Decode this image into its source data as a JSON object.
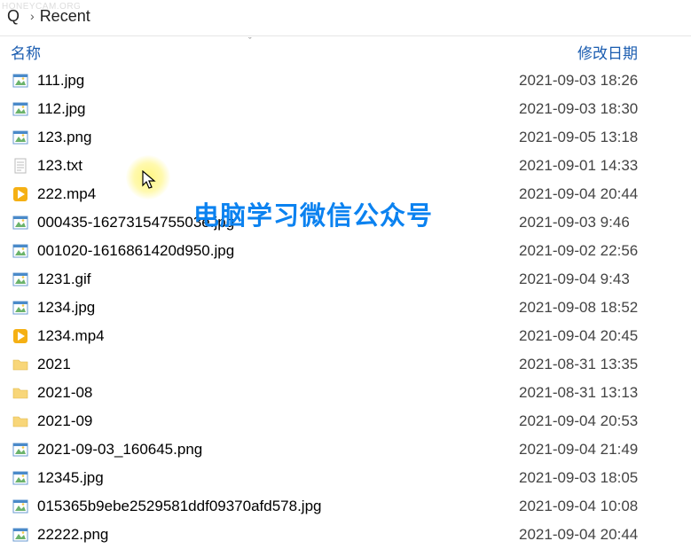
{
  "watermark_corner": "HONEYCAM.ORG",
  "breadcrumb": {
    "drive": "Q",
    "chevron": "›",
    "folder": "Recent"
  },
  "headers": {
    "name": "名称",
    "modified": "修改日期",
    "sort_indicator": "ˇ"
  },
  "overlay_text": "电脑学习微信公众号",
  "files": [
    {
      "icon": "image",
      "name": "111.jpg",
      "date": "2021-09-03 18:26"
    },
    {
      "icon": "image",
      "name": "112.jpg",
      "date": "2021-09-03 18:30"
    },
    {
      "icon": "image",
      "name": "123.png",
      "date": "2021-09-05 13:18"
    },
    {
      "icon": "text",
      "name": "123.txt",
      "date": "2021-09-01 14:33"
    },
    {
      "icon": "video",
      "name": "222.mp4",
      "date": "2021-09-04 20:44"
    },
    {
      "icon": "image",
      "name": "000435-1627315475503e.jpg",
      "date": "2021-09-03 9:46"
    },
    {
      "icon": "image",
      "name": "001020-1616861420d950.jpg",
      "date": "2021-09-02 22:56"
    },
    {
      "icon": "image",
      "name": "1231.gif",
      "date": "2021-09-04 9:43"
    },
    {
      "icon": "image",
      "name": "1234.jpg",
      "date": "2021-09-08 18:52"
    },
    {
      "icon": "video",
      "name": "1234.mp4",
      "date": "2021-09-04 20:45"
    },
    {
      "icon": "folder",
      "name": "2021",
      "date": "2021-08-31 13:35"
    },
    {
      "icon": "folder",
      "name": "2021-08",
      "date": "2021-08-31 13:13"
    },
    {
      "icon": "folder",
      "name": "2021-09",
      "date": "2021-09-04 20:53"
    },
    {
      "icon": "image",
      "name": "2021-09-03_160645.png",
      "date": "2021-09-04 21:49"
    },
    {
      "icon": "image",
      "name": "12345.jpg",
      "date": "2021-09-03 18:05"
    },
    {
      "icon": "image",
      "name": "015365b9ebe2529581ddf09370afd578.jpg",
      "date": "2021-09-04 10:08"
    },
    {
      "icon": "image",
      "name": "22222.png",
      "date": "2021-09-04 20:44"
    }
  ]
}
